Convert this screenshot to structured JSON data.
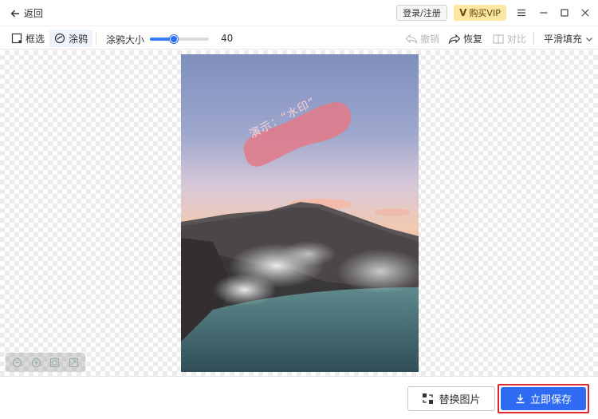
{
  "titlebar": {
    "back_label": "返回",
    "login_label": "登录/注册",
    "vip_mark": "V",
    "vip_label": "购买VIP"
  },
  "toolbar": {
    "select_label": "框选",
    "brush_label": "涂鸦",
    "brush_size_label": "涂鸦大小",
    "brush_size_value": "40",
    "brush_size_fraction": 0.4,
    "undo_label": "撤销",
    "undo_enabled": false,
    "redo_label": "恢复",
    "redo_enabled": true,
    "compare_label": "对比",
    "compare_enabled": false,
    "fill_mode_label": "平滑填充"
  },
  "canvas": {
    "watermark_text": "演示：“水印”"
  },
  "footer": {
    "replace_label": "替换图片",
    "save_label": "立即保存"
  },
  "colors": {
    "accent": "#2f6bf2",
    "highlight_border": "#e0262e",
    "vip_bg": "#fbe7a1",
    "brush_mark": "#e07b8a"
  }
}
